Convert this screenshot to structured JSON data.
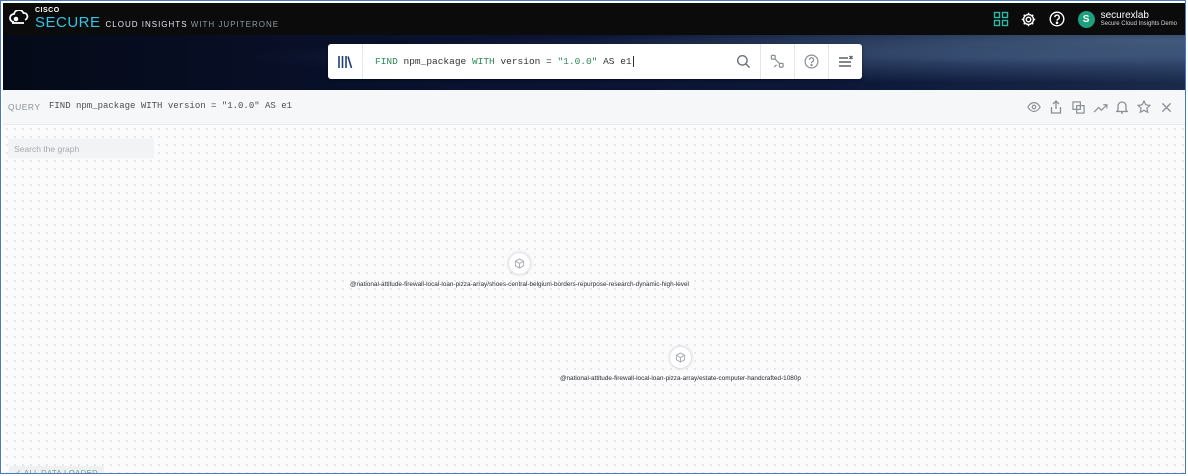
{
  "header": {
    "brand_top": "CISCO",
    "brand_main": "SECURE",
    "brand_sub_a": "CLOUD INSIGHTS",
    "brand_sub_b": "WITH JUPITERONE",
    "icons": [
      "apps-grid-icon",
      "gear-icon",
      "help-icon"
    ],
    "user": {
      "avatar_letter": "S",
      "name": "securexlab",
      "org": "Secure Cloud Insights Demo"
    }
  },
  "search": {
    "query_parts": {
      "kw1": "FIND",
      "entity": " npm_package ",
      "kw2": "WITH",
      "cond": " version = ",
      "value": "\"1.0.0\"",
      "kw3": " AS ",
      "alias": "e1"
    },
    "icons": [
      "library-icon",
      "search-icon",
      "builder-icon",
      "help-icon",
      "menu-clear-icon"
    ]
  },
  "query_bar": {
    "label": "QUERY",
    "text": "FIND npm_package WITH version = \"1.0.0\" AS e1",
    "actions": [
      "eye-icon",
      "share-icon",
      "copy-icon",
      "trend-icon",
      "bell-icon",
      "star-icon",
      "close-icon"
    ]
  },
  "graph": {
    "search_placeholder": "Search the graph",
    "nodes": [
      {
        "label": "@national-attitude-firewall-local-loan-pizza-array/shoes-central-belgium-borders-repurpose-research-dynamic-high-level"
      },
      {
        "label": "@national-attitude-firewall-local-loan-pizza-array/estate-computer-handcrafted-1080p"
      }
    ],
    "footer": "✓ ALL DATA LOADED"
  },
  "colors": {
    "accent": "#35c4e6",
    "header_bg": "#0b0b0c",
    "keyword": "#2e8a5a",
    "avatar": "#1fa07c"
  }
}
